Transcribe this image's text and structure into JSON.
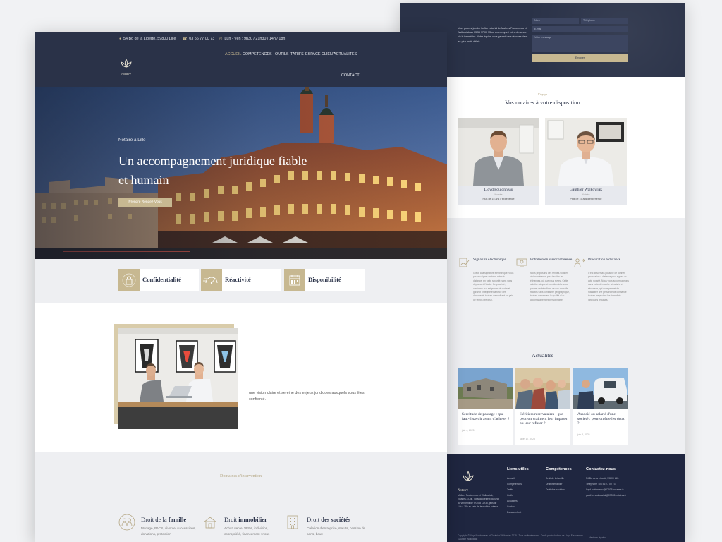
{
  "colors": {
    "navy": "#2a3248",
    "gold": "#c7b891",
    "footer": "#1f2640",
    "grey": "#eeeff2"
  },
  "header": {
    "address": "54 Bd de la Liberté, 59800 Lille",
    "phone": "03 56 77 00 73",
    "hours": "Lun - Ven : 9h30 / 21h30 / 14h / 18h",
    "nav": {
      "home": "ACCUEIL",
      "skills": "COMPÉTENCES",
      "tools": "OUTILS",
      "rates": "TARIFS",
      "client": "ESPACE CLIENT",
      "news": "ACTUALITÉS",
      "contact": "CONTACT"
    },
    "logo_text": "Notaire"
  },
  "hero": {
    "eyebrow": "Notaire à Lille",
    "title": "Un accompagnement juridique fiable et humain",
    "cta": "Prendre Rendez-Vous"
  },
  "values": [
    {
      "label": "Confidentialité",
      "icon": "lock-icon"
    },
    {
      "label": "Réactivité",
      "icon": "speedometer-icon"
    },
    {
      "label": "Disponibilité",
      "icon": "calendar-icon"
    }
  ],
  "intro": {
    "text": "une vision claire et sereine des enjeux juridiques auxquels vous êtes confronté."
  },
  "domains": {
    "eyebrow": "Domaines d'intervention",
    "items": [
      {
        "title_a": "Droit de la ",
        "title_b": "famille",
        "desc": "Mariage, PACS, divorce, successions, donations, protection"
      },
      {
        "title_a": "Droit ",
        "title_b": "immobilier",
        "desc": "Achat, vente, VEFA, indivision, copropriété, financement : nous"
      },
      {
        "title_a": "Droit ",
        "title_b": "des sociétés",
        "desc": "Création d'entreprise, statuts, cession de parts, baux"
      }
    ]
  },
  "contact": {
    "text": "Vous pouvez joindre l'office notarial de Maîtres Foulonneau et Walkowiak au 03 56 77 00 73 ou en envoyant votre demande via le formulaire. Notre équipe vous garantit une réponse dans les plus brefs délais.",
    "name_ph": "Nom",
    "phone_ph": "Téléphone",
    "email_ph": "E-mail",
    "message_ph": "Votre message",
    "send": "Envoyer"
  },
  "notaries": {
    "eyebrow": "L'équipe",
    "title": "Vos notaires à votre disposition",
    "cards": [
      {
        "name": "Lloyd Foulonneau",
        "role": "Notaire",
        "exp": "Plus de 15 ans d'expérience"
      },
      {
        "name": "Gauthier Walkowiak",
        "role": "Notaire",
        "exp": "Plus de 15 ans d'expérience"
      }
    ]
  },
  "services": [
    {
      "title": "Signature électronique",
      "desc": "Grâce à la signature électronique, vous pouvez signer certains actes à distance, en toute sécurité, sans vous déplacer à l'étude. Ce procédé, conforme aux exigences du notariat, garantit l'intégrité et la force des documents tout en vous offrant un gain de temps précieux."
    },
    {
      "title": "Entretien en visioconférence",
      "desc": "Nous proposons des rendez-vous en visioconférence pour faciliter les échanges, où que vous soyez. Cette solution simple et confidentielle vous permet de bénéficier de nos conseils réactifs sans contrainte géographique, tout en conservant la qualité d'un accompagnement personnalisé."
    },
    {
      "title": "Procuration à distance",
      "desc": "C'est désormais possible de donner procuration à distance pour signer un acte notarié. Nous vous accompagnons dans cette démarche sécurisée et sécurisée, qui vous permet de mandater une personne de confiance tout en respectant les formalités juridiques requises."
    }
  ],
  "news": {
    "title": "Actualités",
    "items": [
      {
        "title": "Servitude de passage : que faut-il savoir avant d'acheter ?",
        "date": "juin 4, 2025"
      },
      {
        "title": "Héritiers réservataires : que peut-on vraiment leur imposer ou leur refuser ?",
        "date": "juillet 17, 2025"
      },
      {
        "title": "Associé ou salarié d'une société : peut-on être les deux ?",
        "date": "juin 4, 2025"
      }
    ]
  },
  "footer": {
    "logo_text": "Notaire",
    "about": "Maîtres Foulonneau et Walkowiak, notaires à Lille, vous accueillent du lundi au vendredi de 9h30 à 12h30, puis de 14h à 18h au sein de leur office notarial.",
    "links_title": "Liens utiles",
    "links": [
      "Accueil",
      "Compétences",
      "Tarifs",
      "Outils",
      "Actualités",
      "Contact",
      "Espace client"
    ],
    "skills_title": "Compétences",
    "skills": [
      "Droit de la famille",
      "Droit immobilier",
      "Droit des sociétés"
    ],
    "contact_title": "Contactez-nous",
    "contact_lines": [
      "54 Bd de la Liberté, 59800 Lille",
      "Téléphone : 03 56 77 00 73",
      "lloyd.foulonneau@07035.notaires.fr",
      "gauthier.walkowiak@07035.notaires.fr"
    ],
    "copyright": "Copyright © Lloyd Foulonneau et Gauthier Walkowiak 2025 - Tous droits réservés - Crédit photos/vidéos de Lloyd Foulonneau - Gauthier Walkowiak",
    "legal": "Mentions légales"
  }
}
